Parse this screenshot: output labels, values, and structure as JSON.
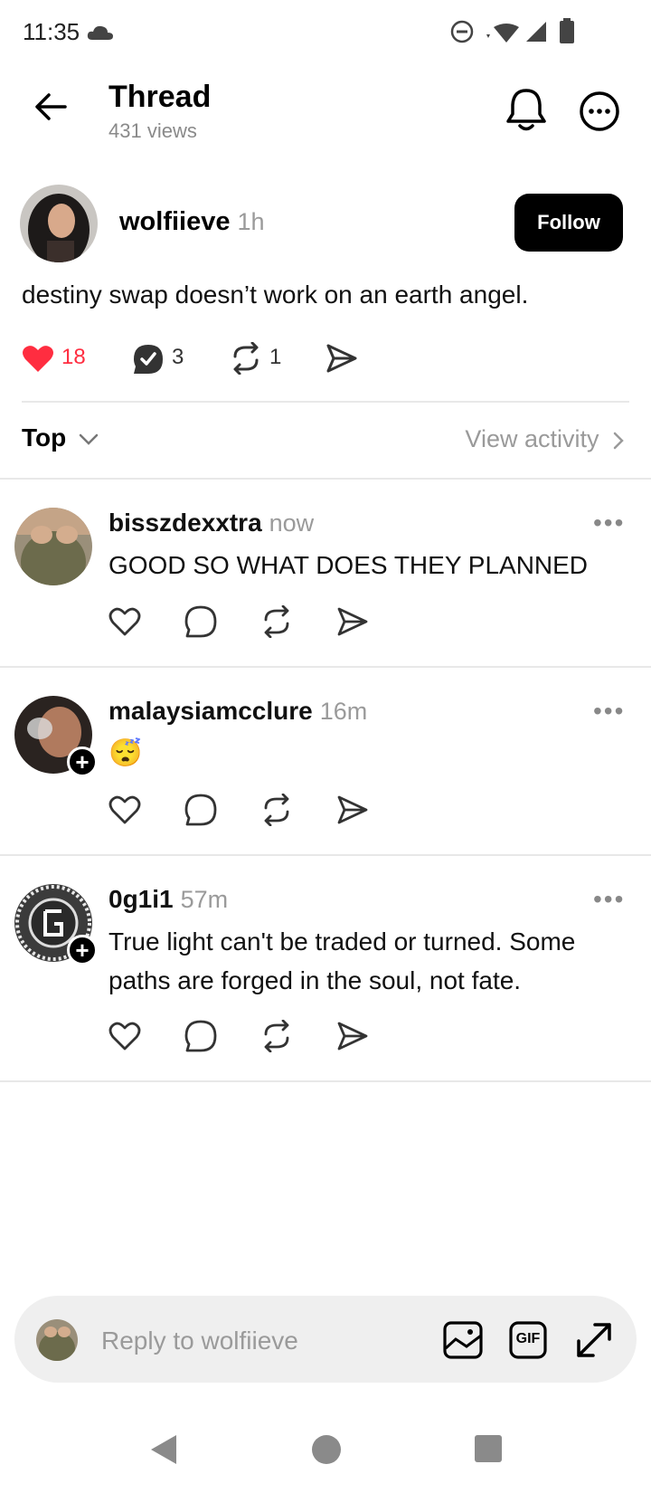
{
  "status_bar": {
    "time": "11:35"
  },
  "header": {
    "title": "Thread",
    "views": "431 views"
  },
  "post": {
    "username": "wolfiieve",
    "time": "1h",
    "follow_label": "Follow",
    "text": "destiny swap doesn’t work on an earth angel.",
    "likes": "18",
    "replies": "3",
    "reposts": "1"
  },
  "sort": {
    "label": "Top",
    "view_activity": "View activity"
  },
  "replies": [
    {
      "username": "bisszdexxtra",
      "time": "now",
      "text": "GOOD SO WHAT DOES THEY PLANNED"
    },
    {
      "username": "malaysiamcclure",
      "time": "16m",
      "text": "😴"
    },
    {
      "username": "0g1i1",
      "time": "57m",
      "text": "True light can't be traded or turned. Some paths are forged in the soul, not fate."
    }
  ],
  "reply_bar": {
    "placeholder": "Reply to wolfiieve",
    "gif_label": "GIF"
  },
  "colors": {
    "like": "#ff2d40",
    "follow_bg": "#000000"
  }
}
